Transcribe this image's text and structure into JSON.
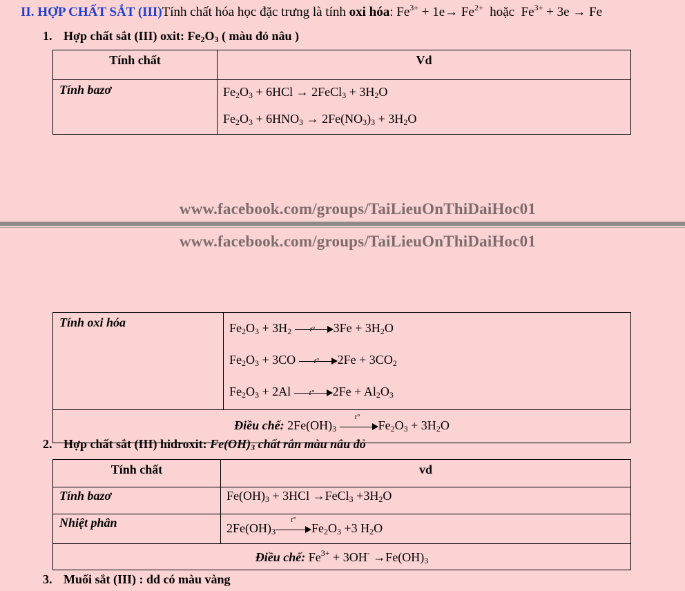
{
  "heading": {
    "section": "II. HỢP CHẤT SẮT (III)",
    "text": "Tính chất hóa học đặc trưng là tính ",
    "bold": "oxi hóa",
    "colon": ": ",
    "eq1a": "Fe",
    "eq1b": "3+",
    "eq1c": " + 1e→ Fe",
    "eq1d": "2+",
    "or": "  hoặc  ",
    "eq2a": "Fe",
    "eq2b": "3+",
    "eq2c": " + 3e → Fe"
  },
  "sec1": {
    "num": "1.",
    "title": "Hợp chất sắt (III) oxit: Fe",
    "s1": "2",
    "o": "O",
    "s2": "3",
    "note": " ( màu đỏ nâu )"
  },
  "sec2": {
    "num": "2.",
    "title": "Hợp chất sắt (III) hidroxit: ",
    "it": "Fe(OH)",
    "s": "3",
    "note": " chất rắn màu nâu đỏ"
  },
  "sec3": {
    "num": "3.",
    "title": "Muối sắt (III) : dd có màu vàng"
  },
  "table1": {
    "col1": "Tính chất",
    "col2": "Vd",
    "row1": "Tính bazơ"
  },
  "table2": {
    "row1": "Tính oxi hóa",
    "prep": "Điều chế:",
    "arrowlabel": "t°"
  },
  "table3": {
    "col1": "Tính chất",
    "col2": "vd",
    "row1": "Tính bazơ",
    "row2": "Nhiệt phân",
    "prep": "Điều chế:"
  },
  "watermark": "www.facebook.com/groups/TaiLieuOnThiDaiHoc01",
  "formula": {
    "Fe": "Fe",
    "O": "O",
    "H": "H",
    "Cl": "Cl",
    "Al": "Al",
    "s2": "2",
    "s3": "3"
  }
}
